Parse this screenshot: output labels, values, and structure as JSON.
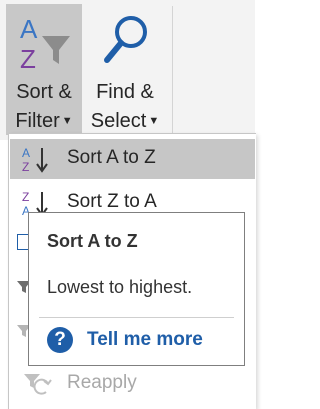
{
  "ribbon": {
    "sort_filter": {
      "label_line1": "Sort &",
      "label_line2": "Filter",
      "icon": "sort-filter-icon"
    },
    "find_select": {
      "label_line1": "Find &",
      "label_line2": "Select",
      "icon": "magnifier-icon"
    }
  },
  "menu": {
    "items": [
      {
        "label": "Sort A to Z",
        "icon": "sort-a-to-z-icon",
        "highlighted": true,
        "enabled": true
      },
      {
        "label": "Sort Z to A",
        "icon": "sort-z-to-a-icon",
        "highlighted": false,
        "enabled": true
      },
      {
        "label": "Reapply",
        "icon": "reapply-icon",
        "highlighted": false,
        "enabled": false
      }
    ]
  },
  "tooltip": {
    "title": "Sort A to Z",
    "description": "Lowest to highest.",
    "help_label": "Tell me more",
    "help_icon": "?"
  },
  "colors": {
    "ribbon_bg": "#f3f3f3",
    "pressed_bg": "#c8c8c8",
    "accent_blue": "#1f5ea8",
    "letter_blue": "#3b76c4",
    "letter_purple": "#7b3f9e"
  }
}
